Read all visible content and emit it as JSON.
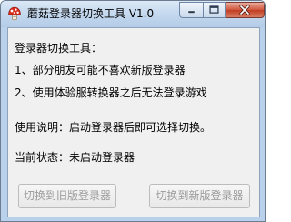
{
  "window": {
    "title": "蘑菇登录器切换工具 V1.0",
    "app_icon": "mushroom-icon",
    "controls": {
      "minimize": "minimize-icon",
      "maximize": "maximize-icon",
      "close": "close-icon"
    }
  },
  "content": {
    "heading": "登录器切换工具：",
    "issue_1": "1、部分朋友可能不喜欢新版登录器",
    "issue_2": "2、使用体验服转换器之后无法登录游戏",
    "usage": "使用说明：启动登录器后即可选择切换。",
    "status": "当前状态：未启动登录器"
  },
  "buttons": {
    "switch_old": "切换到旧版登录器",
    "switch_new": "切换到新版登录器",
    "enabled": false
  },
  "colors": {
    "title_bar": "#c4d8ee",
    "client_bg": "#f0f0f0",
    "close_button": "#c13d22",
    "disabled_text": "#9b9b9b"
  }
}
